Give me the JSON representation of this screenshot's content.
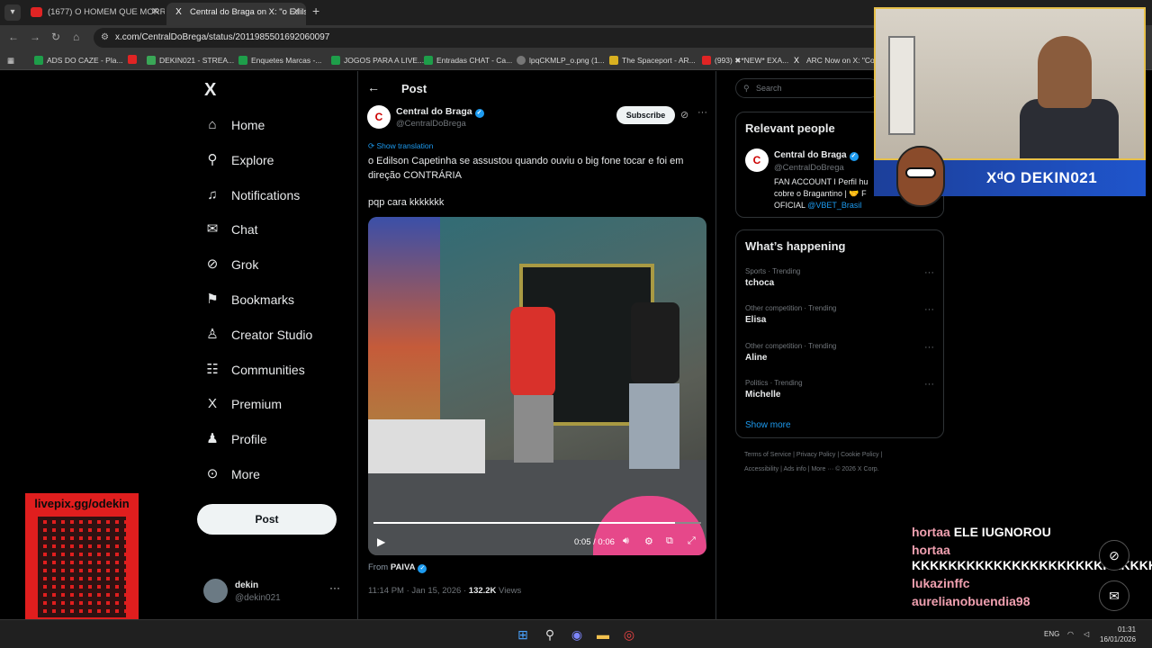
{
  "browser": {
    "tabs": [
      {
        "label": "(1677) O HOMEM QUE MORRE",
        "favicon": "youtube-icon"
      },
      {
        "label": "Central do Braga on X: \"o Edils",
        "favicon": "x-icon"
      }
    ],
    "url": "x.com/CentralDoBrega/status/2011985501692060097",
    "bookmarks": [
      "ADS DO CAZE - Pla...",
      "DEKIN021 - STREA...",
      "Enquetes Marcas -...",
      "JOGOS PARA A LIVE...",
      "Entradas CHAT - Ca...",
      "lpqCKMLP_o.png (1...",
      "The Spaceport - AR...",
      "(993) ✖*NEW* EXA...",
      "ARC Now on X: \"Co..."
    ]
  },
  "x": {
    "logo": "X",
    "nav": [
      {
        "label": "Home",
        "icon": "home-icon",
        "glyph": "⌂"
      },
      {
        "label": "Explore",
        "icon": "search-icon",
        "glyph": "⚲"
      },
      {
        "label": "Notifications",
        "icon": "bell-icon",
        "glyph": "♫"
      },
      {
        "label": "Chat",
        "icon": "envelope-icon",
        "glyph": "✉"
      },
      {
        "label": "Grok",
        "icon": "grok-icon",
        "glyph": "⊘"
      },
      {
        "label": "Bookmarks",
        "icon": "bookmark-icon",
        "glyph": "⚑"
      },
      {
        "label": "Creator Studio",
        "icon": "creator-icon",
        "glyph": "♙"
      },
      {
        "label": "Communities",
        "icon": "communities-icon",
        "glyph": "☷"
      },
      {
        "label": "Premium",
        "icon": "premium-icon",
        "glyph": "X"
      },
      {
        "label": "Profile",
        "icon": "profile-icon",
        "glyph": "♟"
      },
      {
        "label": "More",
        "icon": "more-icon",
        "glyph": "⊙"
      }
    ],
    "post_button": "Post",
    "me": {
      "name": "dekin",
      "handle": "@dekin021"
    },
    "header_title": "Post",
    "author": {
      "name": "Central do Braga",
      "handle": "@CentralDoBrega",
      "avatar_text": "C"
    },
    "subscribe": "Subscribe",
    "show_translation": "Show translation",
    "text_line1": "o Edilson Capetinha se assustou quando ouviu o big fone tocar e foi em direção CONTRÁRIA",
    "text_line2": "pqp cara kkkkkkk",
    "video": {
      "time": "0:05 / 0:06",
      "progress": 0.92
    },
    "from_label": "From",
    "from_user": "PAIVA",
    "meta_time": "11:14 PM · Jan 15, 2026 · ",
    "views_count": "132.2K",
    "views_label": " Views"
  },
  "sidebar": {
    "search_placeholder": "Search",
    "relevant_title": "Relevant people",
    "rp": {
      "name": "Central do Braga",
      "handle": "@CentralDoBrega",
      "bio": "FAN ACCOUNT I Perfil hu cobre o Bragantino | 🤝 F OFICIAL ",
      "bio_link": "@VBET_Brasil"
    },
    "happening_title": "What’s happening",
    "trends": [
      {
        "context": "Sports · Trending",
        "title": "tchoca"
      },
      {
        "context": "Other competition · Trending",
        "title": "Elisa"
      },
      {
        "context": "Other competition · Trending",
        "title": "Aline"
      },
      {
        "context": "Politics · Trending",
        "title": "Michelle"
      }
    ],
    "show_more": "Show more",
    "footer1": "Terms of Service  |  Privacy Policy  |  Cookie Policy  |",
    "footer2": "Accessibility  |  Ads info  |  More ···  © 2026 X Corp."
  },
  "overlay": {
    "qr_label": "livepix.gg/odekin",
    "banner": "XᵈO DEKIN021",
    "chat": [
      {
        "user": "hortaa",
        "msg": "ELE IUGNOROU"
      },
      {
        "user": "hortaa",
        "msg": "KKKKKKKKKKKKKKKKKKKKKKKKKKKKKKKKKKKKK"
      },
      {
        "user": "lukazinffc",
        "msg": ""
      },
      {
        "user": "aurelianobuendia98",
        "msg": ""
      }
    ]
  },
  "taskbar": {
    "lang": "ENG",
    "time": "01:31",
    "date": "16/01/2026"
  }
}
